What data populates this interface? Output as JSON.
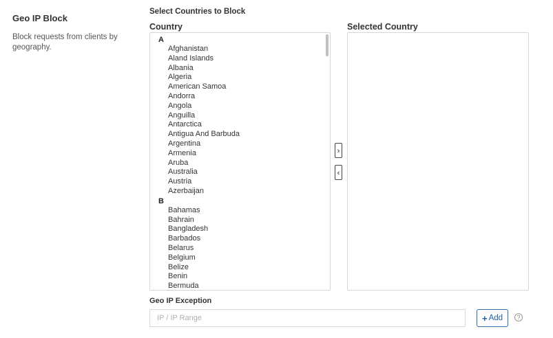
{
  "section": {
    "title": "Geo IP Block",
    "description": "Block requests from clients by geography."
  },
  "selector": {
    "heading": "Select Countries to Block",
    "country_column": "Country",
    "selected_column": "Selected Country",
    "move_right": "›",
    "move_left": "‹",
    "groups": [
      {
        "letter": "A",
        "countries": [
          "Afghanistan",
          "Aland Islands",
          "Albania",
          "Algeria",
          "American Samoa",
          "Andorra",
          "Angola",
          "Anguilla",
          "Antarctica",
          "Antigua And Barbuda",
          "Argentina",
          "Armenia",
          "Aruba",
          "Australia",
          "Austria",
          "Azerbaijan"
        ]
      },
      {
        "letter": "B",
        "countries": [
          "Bahamas",
          "Bahrain",
          "Bangladesh",
          "Barbados",
          "Belarus",
          "Belgium",
          "Belize",
          "Benin",
          "Bermuda"
        ]
      }
    ],
    "selected": []
  },
  "exception": {
    "label": "Geo IP Exception",
    "placeholder": "IP / IP Range",
    "value": "",
    "add_label": "Add",
    "add_icon": "plus-icon",
    "help_icon": "question-circle-icon",
    "help_glyph": "?"
  },
  "colors": {
    "accent": "#2f6fb0",
    "border": "#d6d6d6"
  }
}
